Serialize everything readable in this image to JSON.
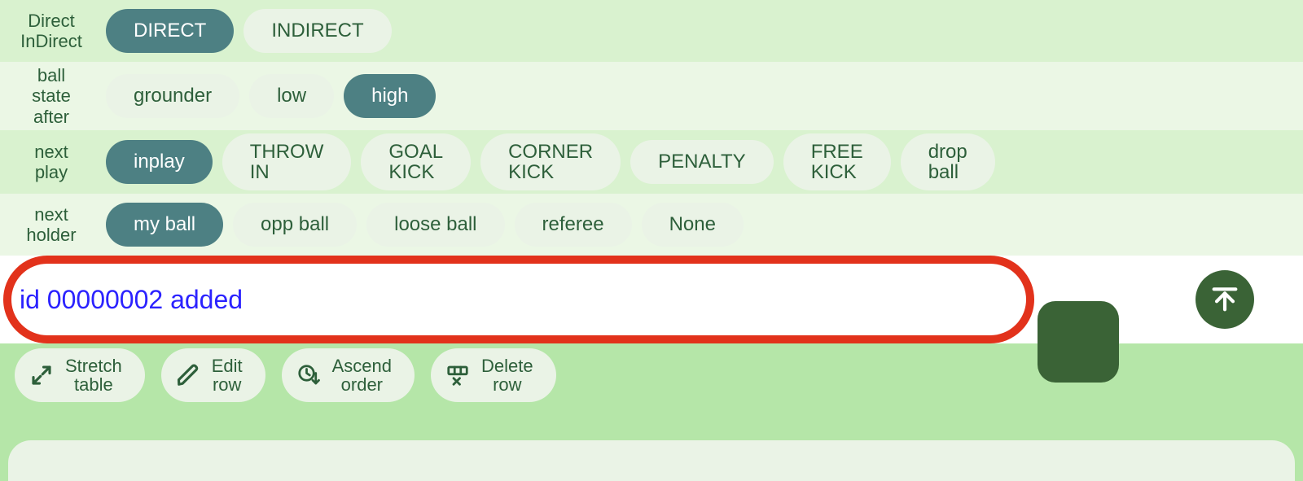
{
  "rows": {
    "direct_indirect": {
      "label_line1": "Direct",
      "label_line2": "InDirect",
      "options": {
        "direct": "DIRECT",
        "indirect": "INDIRECT"
      },
      "selected": "direct"
    },
    "ball_state_after": {
      "label_line1": "ball",
      "label_line2": "state",
      "label_line3": "after",
      "options": {
        "grounder": "grounder",
        "low": "low",
        "high": "high"
      },
      "selected": "high"
    },
    "next_play": {
      "label_line1": "next",
      "label_line2": "play",
      "options": {
        "inplay": "inplay",
        "throw_in_l1": "THROW",
        "throw_in_l2": "IN",
        "goal_kick_l1": "GOAL",
        "goal_kick_l2": "KICK",
        "corner_kick_l1": "CORNER",
        "corner_kick_l2": "KICK",
        "penalty": "PENALTY",
        "free_kick_l1": "FREE",
        "free_kick_l2": "KICK",
        "drop_ball_l1": "drop",
        "drop_ball_l2": "ball"
      },
      "selected": "inplay"
    },
    "next_holder": {
      "label_line1": "next",
      "label_line2": "holder",
      "options": {
        "my_ball": "my ball",
        "opp_ball": "opp ball",
        "loose_ball": "loose ball",
        "referee": "referee",
        "none": "None"
      },
      "selected": "my_ball"
    }
  },
  "status_message": "id 00000002 added",
  "action_buttons": {
    "stretch_table_l1": "Stretch",
    "stretch_table_l2": "table",
    "edit_row_l1": "Edit",
    "edit_row_l2": "row",
    "ascend_order_l1": "Ascend",
    "ascend_order_l2": "order",
    "delete_row_l1": "Delete",
    "delete_row_l2": "row"
  },
  "colors": {
    "bg": "#b5e6a8",
    "row_light": "#ebf7e5",
    "row_dark": "#d9f2cf",
    "pill_bg": "#eaf3e6",
    "pill_selected": "#4d8083",
    "text": "#2d5f3a",
    "status_border": "#e2321b",
    "status_text": "#2b22ff",
    "fab": "#3a6336"
  }
}
